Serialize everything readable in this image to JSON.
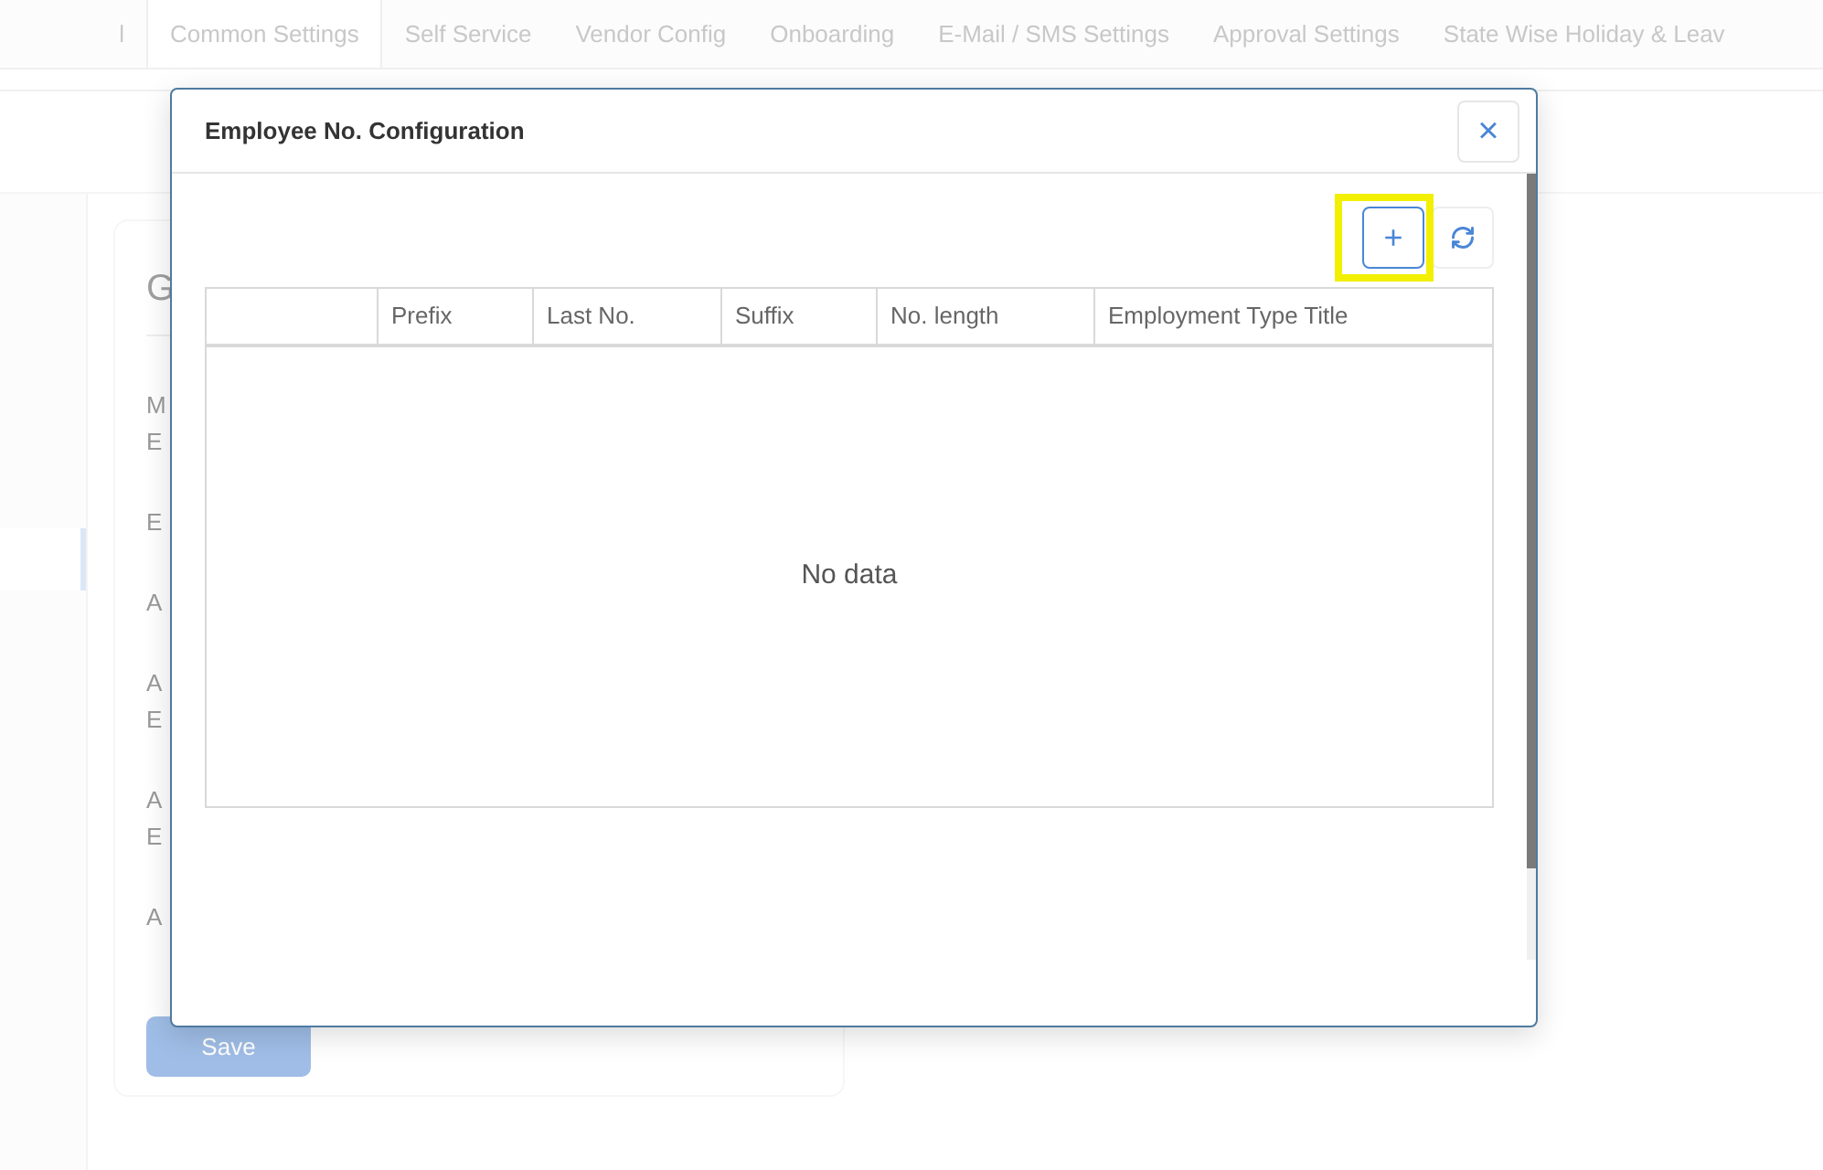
{
  "tabs": [
    {
      "label": "l",
      "selected": false
    },
    {
      "label": "Common Settings",
      "selected": true
    },
    {
      "label": "Self Service",
      "selected": false
    },
    {
      "label": "Vendor Config",
      "selected": false
    },
    {
      "label": "Onboarding",
      "selected": false
    },
    {
      "label": "E-Mail / SMS Settings",
      "selected": false
    },
    {
      "label": "Approval Settings",
      "selected": false
    },
    {
      "label": "State Wise Holiday & Leav",
      "selected": false
    }
  ],
  "card": {
    "heading": "G",
    "labels": [
      "M\nE",
      "E",
      "A",
      "A\nE",
      "A\nE",
      "A"
    ],
    "save_button": "Save"
  },
  "modal": {
    "title": "Employee No. Configuration",
    "close": "×",
    "add": "+",
    "table": {
      "columns": [
        "",
        "Prefix",
        "Last No.",
        "Suffix",
        "No. length",
        "Employment Type Title"
      ],
      "empty_text": "No data"
    }
  }
}
